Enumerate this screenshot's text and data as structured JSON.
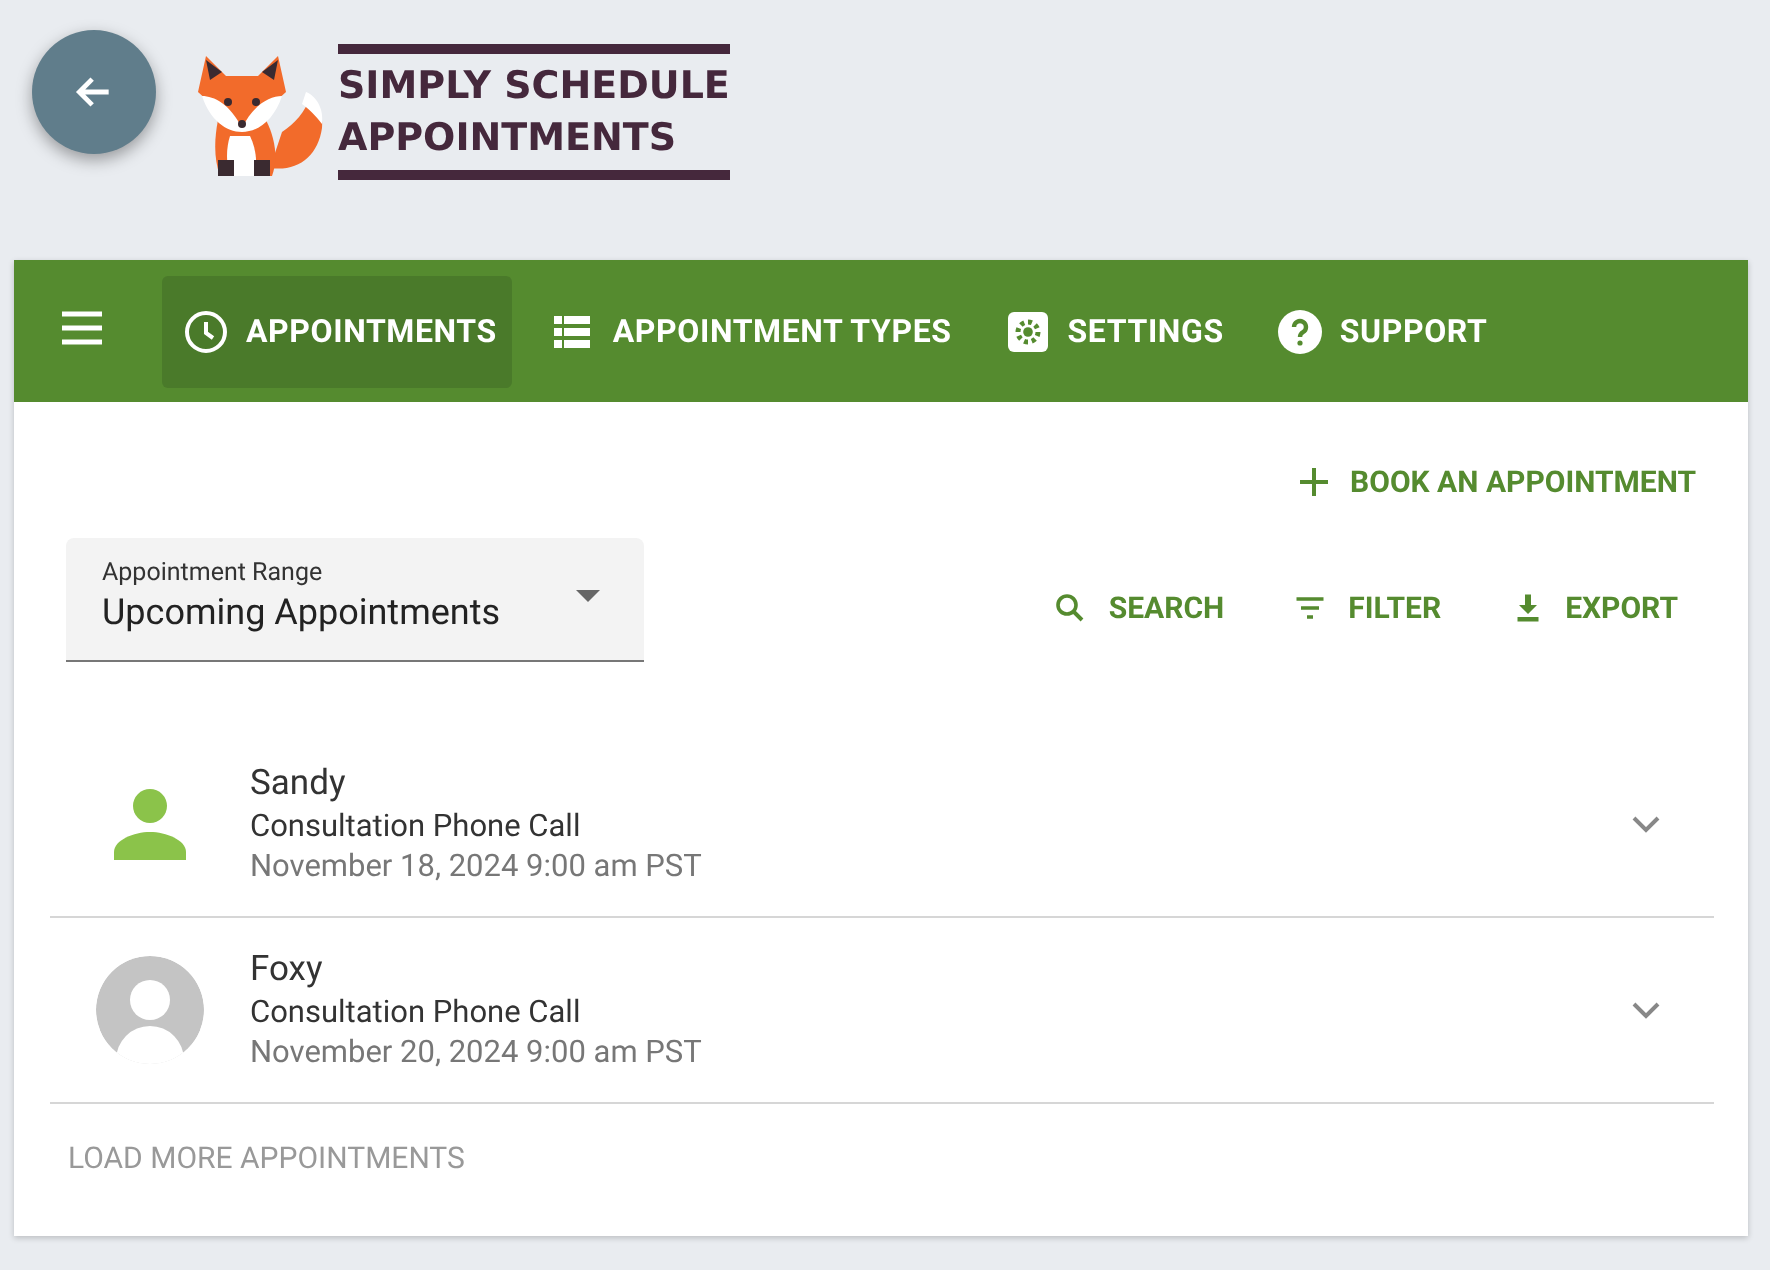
{
  "logo": {
    "line_1": "SIMPLY SCHEDULE",
    "line_2": "APPOINTMENTS"
  },
  "tabs": [
    {
      "label": "APPOINTMENTS",
      "kind": "clock",
      "selected": true
    },
    {
      "label": "APPOINTMENT TYPES",
      "kind": "table",
      "selected": false
    },
    {
      "label": "SETTINGS",
      "kind": "gear",
      "selected": false
    },
    {
      "label": "SUPPORT",
      "kind": "help",
      "selected": false
    }
  ],
  "book_button": "BOOK AN APPOINTMENT",
  "range_field": {
    "label": "Appointment Range",
    "value": "Upcoming Appointments"
  },
  "actions": [
    {
      "label": "SEARCH",
      "kind": "search"
    },
    {
      "label": "FILTER",
      "kind": "filter"
    },
    {
      "label": "EXPORT",
      "kind": "download"
    }
  ],
  "appointments": [
    {
      "name": "Sandy",
      "type": "Consultation Phone Call",
      "when": "November 18, 2024 9:00 am PST",
      "kind": "person"
    },
    {
      "name": "Foxy",
      "type": "Consultation Phone Call",
      "when": "November 20, 2024 9:00 am PST",
      "kind": "default"
    }
  ],
  "load_more": "LOAD MORE APPOINTMENTS"
}
